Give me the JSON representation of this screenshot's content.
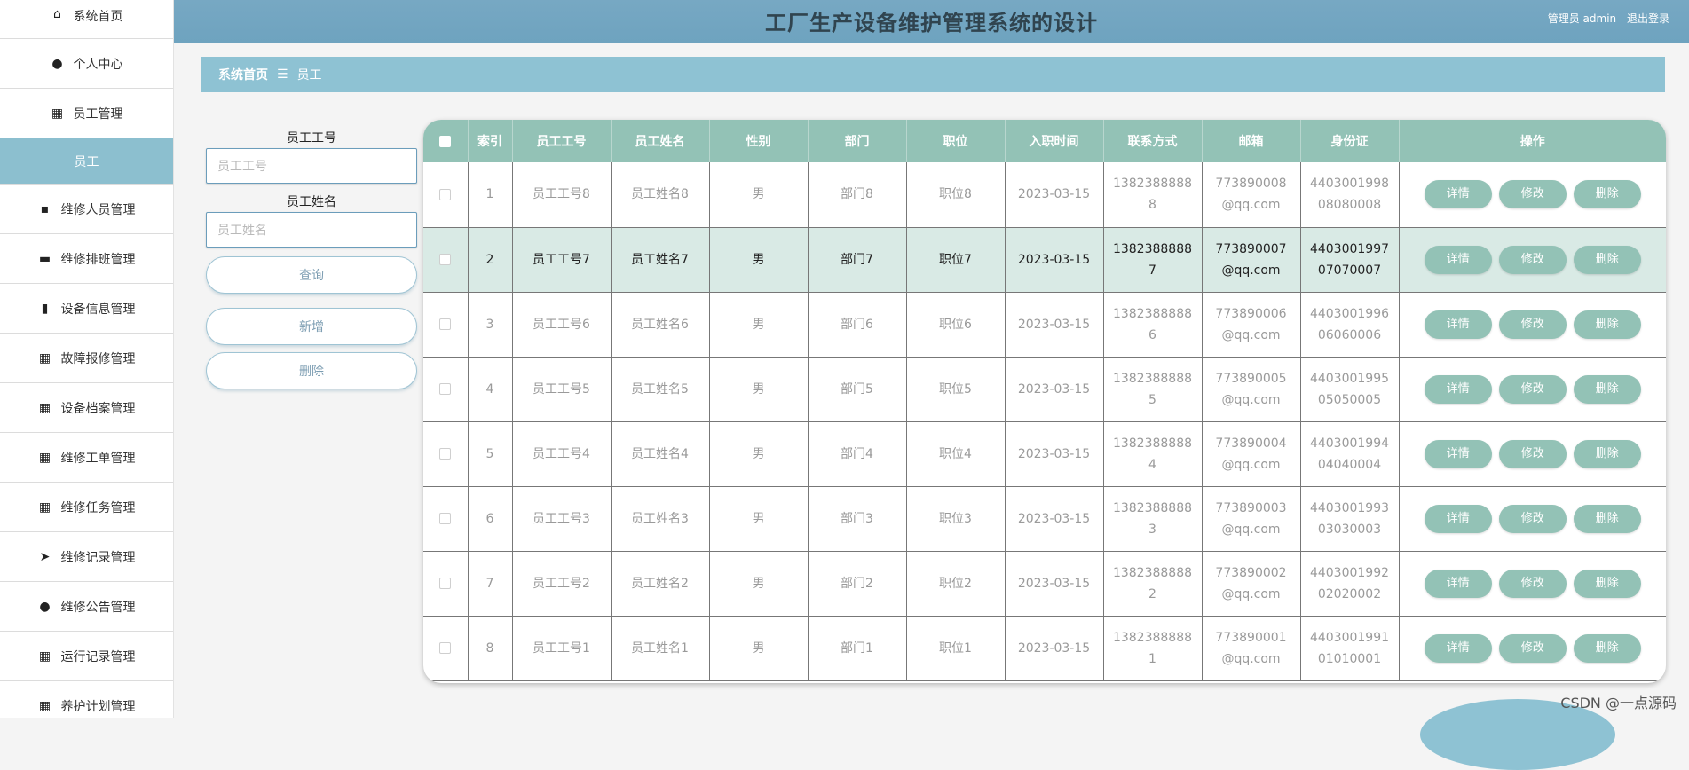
{
  "header": {
    "title": "工厂生产设备维护管理系统的设计",
    "user_label": "管理员 admin",
    "logout": "退出登录"
  },
  "sidebar": {
    "items": [
      {
        "label": "系统首页",
        "icon": "home-icon",
        "glyph": "⌂"
      },
      {
        "label": "个人中心",
        "icon": "person-icon",
        "glyph": "●"
      },
      {
        "label": "员工管理",
        "icon": "grid-icon",
        "glyph": "▦"
      },
      {
        "label": "员工",
        "icon": "",
        "glyph": ""
      },
      {
        "label": "维修人员管理",
        "icon": "chat-icon",
        "glyph": "▪"
      },
      {
        "label": "维修排班管理",
        "icon": "monitor-icon",
        "glyph": "▬"
      },
      {
        "label": "设备信息管理",
        "icon": "briefcase-icon",
        "glyph": "▮"
      },
      {
        "label": "故障报修管理",
        "icon": "grid-icon",
        "glyph": "▦"
      },
      {
        "label": "设备档案管理",
        "icon": "grid-icon",
        "glyph": "▦"
      },
      {
        "label": "维修工单管理",
        "icon": "grid-icon",
        "glyph": "▦"
      },
      {
        "label": "维修任务管理",
        "icon": "grid-icon",
        "glyph": "▦"
      },
      {
        "label": "维修记录管理",
        "icon": "send-icon",
        "glyph": "➤"
      },
      {
        "label": "维修公告管理",
        "icon": "person-icon",
        "glyph": "●"
      },
      {
        "label": "运行记录管理",
        "icon": "grid-icon",
        "glyph": "▦"
      },
      {
        "label": "养护计划管理",
        "icon": "grid-icon",
        "glyph": "▦"
      }
    ]
  },
  "breadcrumb": {
    "home": "系统首页",
    "separator": "☰",
    "current": "员工"
  },
  "search": {
    "id_label": "员工工号",
    "id_placeholder": "员工工号",
    "name_label": "员工姓名",
    "name_placeholder": "员工姓名",
    "query_button": "查询",
    "add_button": "新增",
    "delete_button": "删除"
  },
  "table": {
    "columns": [
      "索引",
      "员工工号",
      "员工姓名",
      "性别",
      "部门",
      "职位",
      "入职时间",
      "联系方式",
      "邮箱",
      "身份证",
      "操作"
    ],
    "actions": {
      "detail": "详情",
      "edit": "修改",
      "delete": "删除"
    },
    "rows": [
      {
        "index": "1",
        "emp_id": "员工工号8",
        "name": "员工姓名8",
        "gender": "男",
        "dept": "部门8",
        "position": "职位8",
        "date": "2023-03-15",
        "phone": "13823888888",
        "email": "773890008@qq.com",
        "idcard": "440300199808080008"
      },
      {
        "index": "2",
        "emp_id": "员工工号7",
        "name": "员工姓名7",
        "gender": "男",
        "dept": "部门7",
        "position": "职位7",
        "date": "2023-03-15",
        "phone": "13823888887",
        "email": "773890007@qq.com",
        "idcard": "440300199707070007"
      },
      {
        "index": "3",
        "emp_id": "员工工号6",
        "name": "员工姓名6",
        "gender": "男",
        "dept": "部门6",
        "position": "职位6",
        "date": "2023-03-15",
        "phone": "13823888886",
        "email": "773890006@qq.com",
        "idcard": "440300199606060006"
      },
      {
        "index": "4",
        "emp_id": "员工工号5",
        "name": "员工姓名5",
        "gender": "男",
        "dept": "部门5",
        "position": "职位5",
        "date": "2023-03-15",
        "phone": "13823888885",
        "email": "773890005@qq.com",
        "idcard": "440300199505050005"
      },
      {
        "index": "5",
        "emp_id": "员工工号4",
        "name": "员工姓名4",
        "gender": "男",
        "dept": "部门4",
        "position": "职位4",
        "date": "2023-03-15",
        "phone": "13823888884",
        "email": "773890004@qq.com",
        "idcard": "440300199404040004"
      },
      {
        "index": "6",
        "emp_id": "员工工号3",
        "name": "员工姓名3",
        "gender": "男",
        "dept": "部门3",
        "position": "职位3",
        "date": "2023-03-15",
        "phone": "13823888883",
        "email": "773890003@qq.com",
        "idcard": "440300199303030003"
      },
      {
        "index": "7",
        "emp_id": "员工工号2",
        "name": "员工姓名2",
        "gender": "男",
        "dept": "部门2",
        "position": "职位2",
        "date": "2023-03-15",
        "phone": "13823888882",
        "email": "773890002@qq.com",
        "idcard": "440300199202020002"
      },
      {
        "index": "8",
        "emp_id": "员工工号1",
        "name": "员工姓名1",
        "gender": "男",
        "dept": "部门1",
        "position": "职位1",
        "date": "2023-03-15",
        "phone": "13823888881",
        "email": "773890001@qq.com",
        "idcard": "440300199101010001"
      }
    ]
  },
  "watermark": "CSDN @一点源码",
  "colors": {
    "header": "#6ea3bf",
    "breadcrumb": "#8ec2d3",
    "table_head": "#93c2b6",
    "active_menu": "#8cbfcf"
  }
}
